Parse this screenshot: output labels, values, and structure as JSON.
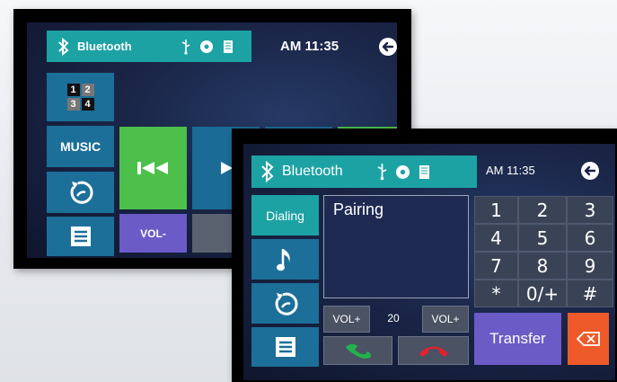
{
  "back_screen": {
    "header": {
      "title": "Bluetooth",
      "time": "AM 11:35"
    },
    "grid_numbers": [
      "1",
      "2",
      "3",
      "4"
    ],
    "music_label": "MUSIC",
    "vol_minus_label": "VOL-"
  },
  "front_screen": {
    "header": {
      "title": "Bluetooth",
      "time": "AM 11:35"
    },
    "dialing_label": "Dialing",
    "display_text": "Pairing",
    "vol_up_left_label": "VOL+",
    "volume_value": "20",
    "vol_up_right_label": "VOL+",
    "keypad": [
      "1",
      "2",
      "3",
      "4",
      "5",
      "6",
      "7",
      "8",
      "9",
      "*",
      "0/+",
      "#"
    ],
    "transfer_label": "Transfer"
  },
  "colors": {
    "teal_bar": "#1da2a4",
    "green": "#4cc04a",
    "purple": "#6a5bc7",
    "orange": "#ee5a2a",
    "answer_icon": "#22b24c",
    "hangup_icon": "#e0212e"
  }
}
